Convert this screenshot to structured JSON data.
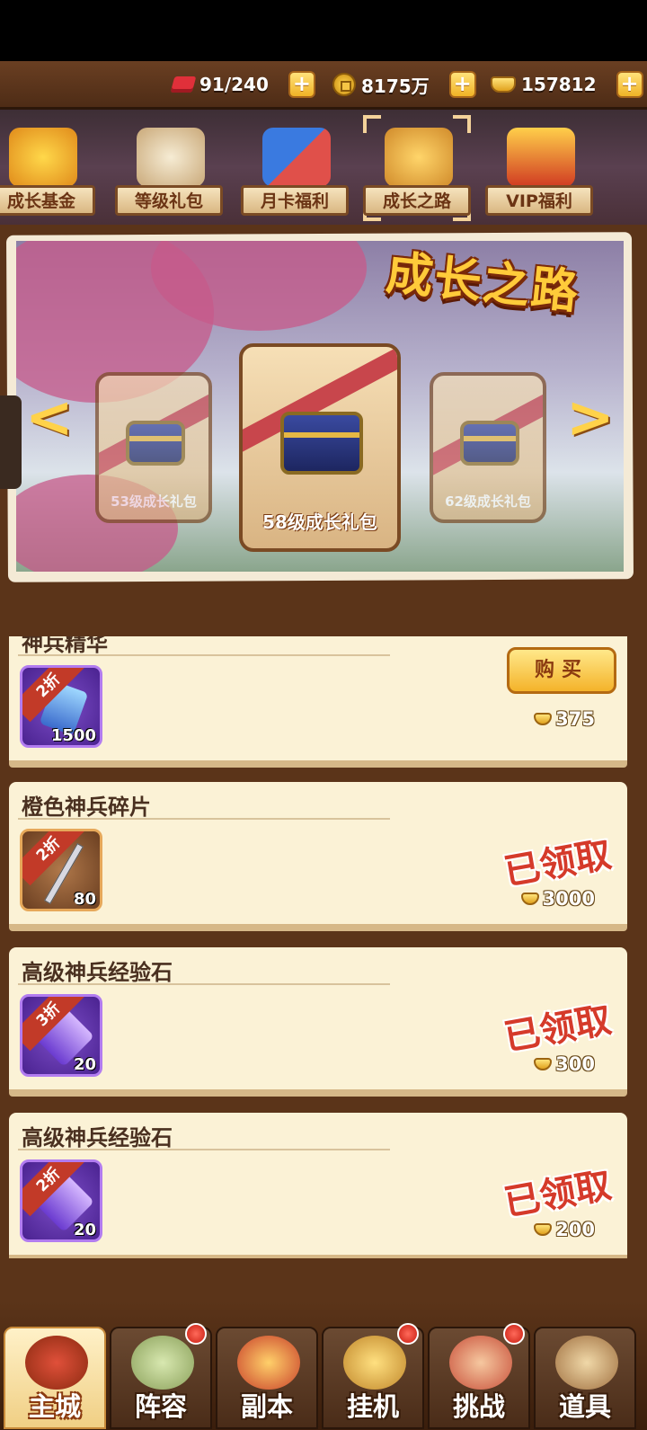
{
  "resources": [
    {
      "icon": "stamina-gem-icon",
      "value": "91/240"
    },
    {
      "icon": "copper-coin-icon",
      "value": "8175万"
    },
    {
      "icon": "gold-ingot-icon",
      "value": "157812"
    }
  ],
  "plus_symbol": "+",
  "tabs": [
    {
      "label": "成长基金"
    },
    {
      "label": "等级礼包"
    },
    {
      "label": "月卡福利"
    },
    {
      "label": "成长之路"
    },
    {
      "label": "VIP福利"
    }
  ],
  "banner": {
    "title": "成长之路",
    "prev_arrow": "<",
    "next_arrow": ">",
    "cards": [
      {
        "label": "53级成长礼包"
      },
      {
        "label": "58级成长礼包"
      },
      {
        "label": "62级成长礼包"
      }
    ]
  },
  "items": [
    {
      "title": "神兵精华",
      "discount": "2折",
      "qty": "1500",
      "action": "购买",
      "price": "375"
    },
    {
      "title": "橙色神兵碎片",
      "discount": "2折",
      "qty": "80",
      "status": "已领取",
      "price": "3000"
    },
    {
      "title": "高级神兵经验石",
      "discount": "3折",
      "qty": "20",
      "status": "已领取",
      "price": "300"
    },
    {
      "title": "高级神兵经验石",
      "discount": "2折",
      "qty": "20",
      "status": "已领取",
      "price": "200"
    }
  ],
  "nav": [
    {
      "label": "主城"
    },
    {
      "label": "阵容"
    },
    {
      "label": "副本"
    },
    {
      "label": "挂机"
    },
    {
      "label": "挑战"
    },
    {
      "label": "道具"
    }
  ]
}
